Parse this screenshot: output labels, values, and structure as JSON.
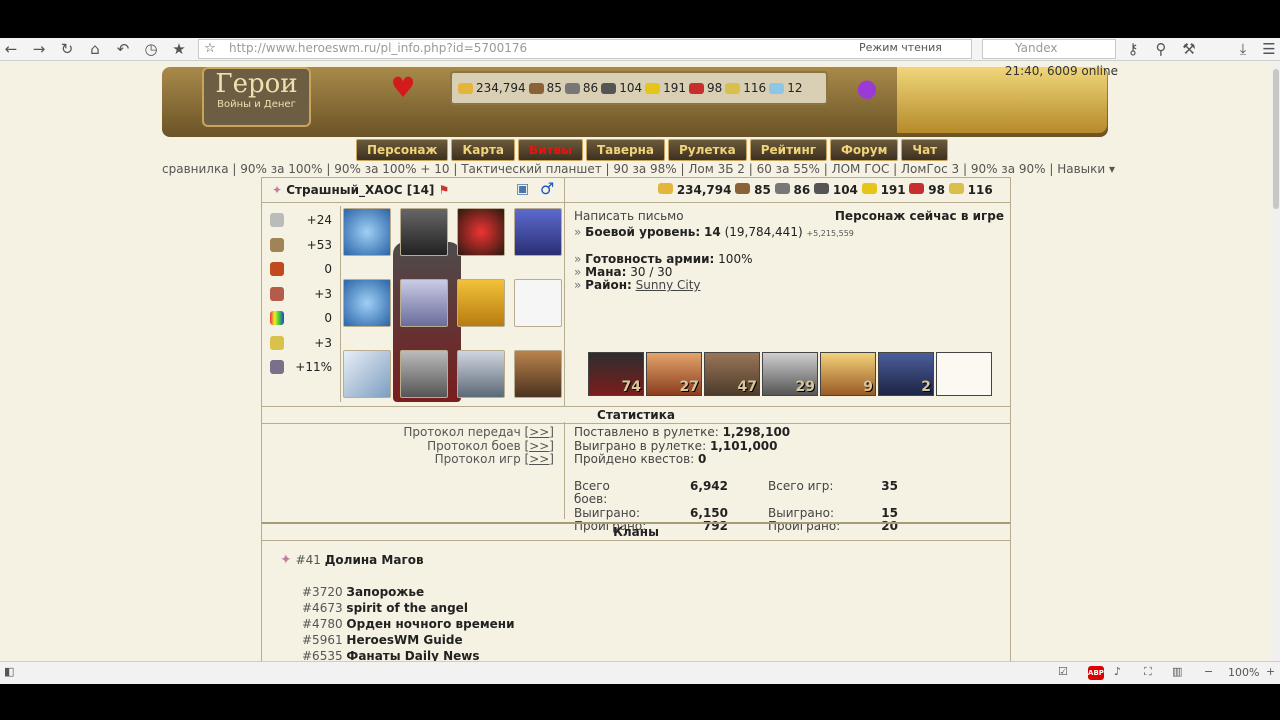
{
  "browser": {
    "url": "http://www.heroeswm.ru/pl_info.php?id=5700176",
    "reader_mode": "Режим чтения",
    "search_placeholder": "Yandex",
    "zoom": "100%",
    "adblock": "ABP"
  },
  "header": {
    "logo_title": "Герои",
    "logo_subtitle": "Войны и Денег",
    "time_online": "21:40, 6009 online",
    "resources": {
      "gold": "234,794",
      "wood": "85",
      "ore": "86",
      "mercury": "104",
      "sulfur": "191",
      "crystals": "98",
      "gems": "116",
      "diamonds": "12"
    },
    "nav": [
      "Персонаж",
      "Карта",
      "Битвы",
      "Таверна",
      "Рулетка",
      "Рейтинг",
      "Форум",
      "Чат"
    ]
  },
  "quicklinks": "сравнилка | 90% за 100% | 90% за 100% + 10 | Тактический планшет | 90 за 98% | Лом 3Б 2 | 60 за 55% | ЛОМ ГОС | ЛомГос 3 | 90% за 90% | Навыки ▾",
  "player": {
    "name": "Страшный_ХАОС",
    "level": "[14]",
    "gold": "234,794",
    "wood": "85",
    "ore": "86",
    "mercury": "104",
    "sulfur": "191",
    "crystals": "98",
    "gems": "116"
  },
  "stats": [
    {
      "icon": "attack-icon",
      "value": "+24"
    },
    {
      "icon": "defense-icon",
      "value": "+53"
    },
    {
      "icon": "spellpower-icon",
      "value": "0"
    },
    {
      "icon": "knowledge-icon",
      "value": "+3"
    },
    {
      "icon": "luck-icon",
      "value": "0"
    },
    {
      "icon": "morale-icon",
      "value": "+3"
    },
    {
      "icon": "initiative-icon",
      "value": "+11%"
    }
  ],
  "info": {
    "write_letter": "Написать письмо",
    "online_status": "Персонаж сейчас в игре",
    "combat_level_label": "Боевой уровень:",
    "combat_level": "14",
    "experience": "(19,784,441)",
    "exp_extra": "+5,215,559",
    "army_ready_label": "Готовность армии:",
    "army_ready": "100%",
    "mana_label": "Мана:",
    "mana": "30 / 30",
    "district_label": "Район:",
    "district": "Sunny City"
  },
  "army": [
    "74",
    "27",
    "47",
    "29",
    "9",
    "2",
    ""
  ],
  "statistics": {
    "title": "Статистика",
    "protocol_transfers": "Протокол передач",
    "protocol_battles": "Протокол боев",
    "protocol_games": "Протокол игр",
    "link": "[>>]",
    "roulette_bet_label": "Поставлено в рулетке:",
    "roulette_bet": "1,298,100",
    "roulette_won_label": "Выиграно в рулетке:",
    "roulette_won": "1,101,000",
    "quests_label": "Пройдено квестов:",
    "quests": "0",
    "battles_total_label": "Всего боев:",
    "battles_total": "6,942",
    "battles_won_label": "Выиграно:",
    "battles_won": "6,150",
    "battles_lost_label": "Проиграно:",
    "battles_lost": "792",
    "games_total_label": "Всего игр:",
    "games_total": "35",
    "games_won_label": "Выиграно:",
    "games_won": "15",
    "games_lost_label": "Проиграно:",
    "games_lost": "20"
  },
  "clans": {
    "title": "Кланы",
    "main_num": "#41",
    "main_name": "Долина Магов",
    "list": [
      {
        "num": "#3720",
        "name": "Запорожье"
      },
      {
        "num": "#4673",
        "name": "spirit of the angel"
      },
      {
        "num": "#4780",
        "name": "Орден ночного времени"
      },
      {
        "num": "#5961",
        "name": "HeroesWM Guide"
      },
      {
        "num": "#6535",
        "name": "Фанаты Daily News"
      }
    ]
  },
  "colors": {
    "page_bg": "#f5f1e3",
    "border": "#b9ad8f",
    "nav_text": "#f0d37a",
    "nav_active": "#e11"
  }
}
